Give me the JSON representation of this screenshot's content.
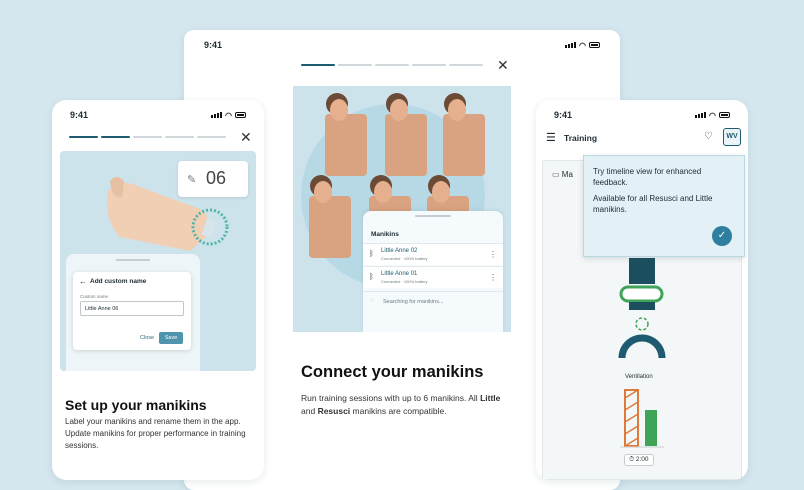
{
  "status_time": "9:41",
  "left": {
    "name_badge": "06",
    "dialog_title": "Add custom name",
    "field_label": "Custom name",
    "field_value": "Little Anne 06",
    "close_label": "Close",
    "save_label": "Save",
    "heading": "Set up your manikins",
    "body": "Label your manikins and rename them in the app. Update manikins for proper performance in training sessions."
  },
  "center": {
    "panel_title": "Manikins",
    "devices": [
      {
        "name": "Little Anne 02",
        "sub": "Connected · 100% battery"
      },
      {
        "name": "Little Anne 01",
        "sub": "Connected · 100% battery"
      }
    ],
    "searching": "Searching for manikins...",
    "heading": "Connect your manikins",
    "body_1": "Run training sessions with up to 6 manikins. All",
    "body_bold_1": "Little",
    "body_and": "and",
    "body_bold_2": "Resusci",
    "body_2": "manikins are compatible."
  },
  "right": {
    "title": "Training",
    "row_label": "Ma",
    "tooltip_line1": "Try timeline view for enhanced feedback.",
    "tooltip_line2": "Available for all Resusci and Little manikins.",
    "ventilation_label": "Ventilation",
    "timer": "2:00"
  },
  "colors": {
    "accent": "#1e5b70",
    "green": "#3fa457",
    "orange": "#e07a3a",
    "bg": "#d5e7ee"
  }
}
